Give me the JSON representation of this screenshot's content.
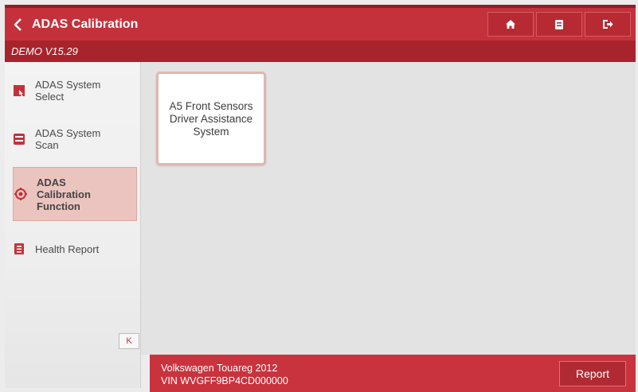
{
  "header": {
    "title": "ADAS Calibration",
    "version": "DEMO V15.29",
    "buttons": [
      {
        "icon": "home-icon"
      },
      {
        "icon": "document-icon"
      },
      {
        "icon": "exit-icon"
      }
    ]
  },
  "sidebar": {
    "items": [
      {
        "label": "ADAS System\nSelect",
        "icon": "select-icon",
        "active": false
      },
      {
        "label": "ADAS System\nScan",
        "icon": "scan-icon",
        "active": false
      },
      {
        "label": "ADAS\nCalibration\nFunction",
        "icon": "target-icon",
        "active": true
      },
      {
        "label": "Health Report",
        "icon": "clipboard-icon",
        "active": false
      }
    ],
    "collapse_label": "K"
  },
  "content": {
    "tiles": [
      {
        "label": "A5 Front Sensors\nDriver Assistance\nSystem"
      }
    ]
  },
  "footer": {
    "vehicle": "Volkswagen Touareg 2012",
    "vin": "VIN WVGFF9BP4CD000000",
    "report_label": "Report"
  },
  "colors": {
    "header": "#c5313b",
    "subheader": "#a8242c",
    "active_item": "#ecc4bf",
    "icon": "#c5313b"
  }
}
